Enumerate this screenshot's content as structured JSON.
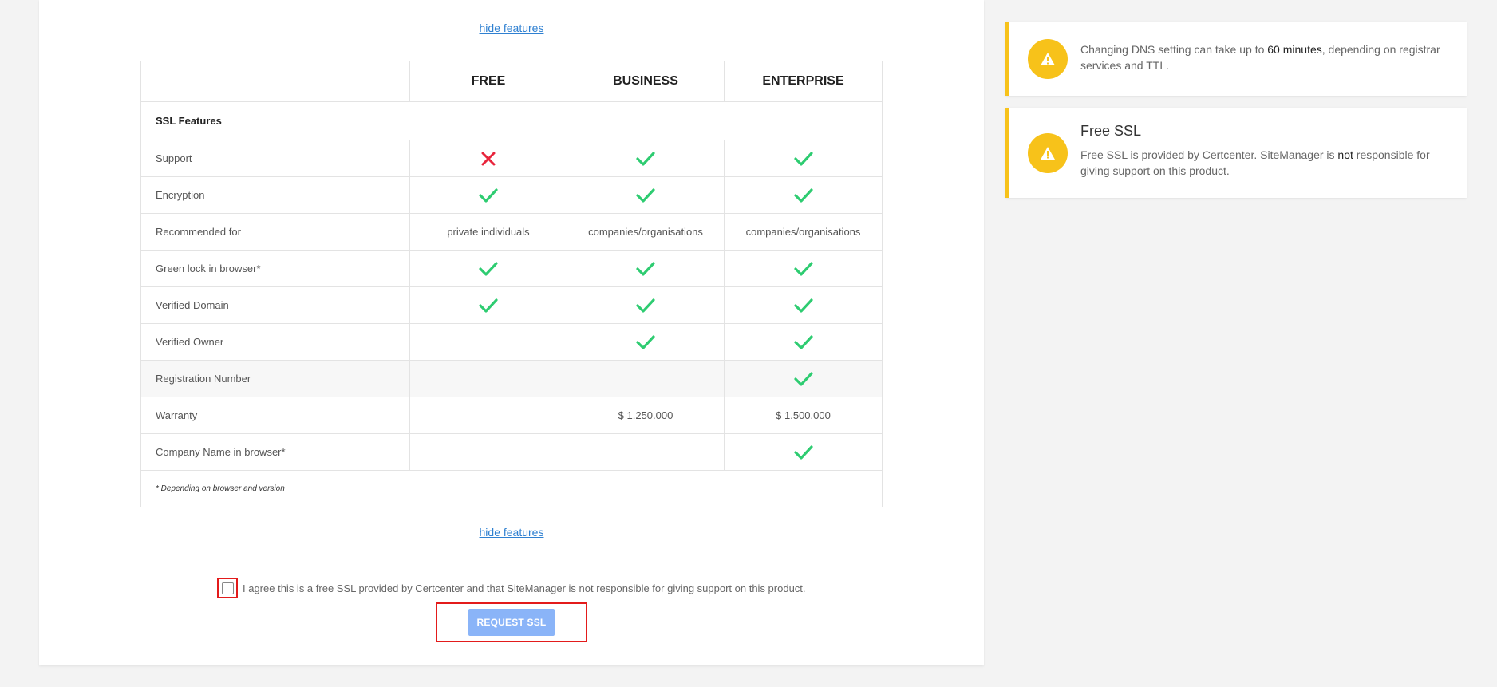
{
  "links": {
    "hide_features_top": "hide features",
    "hide_features_bottom": "hide features"
  },
  "table": {
    "columns": [
      "",
      "FREE",
      "BUSINESS",
      "ENTERPRISE"
    ],
    "section_title": "SSL Features",
    "rows": [
      {
        "label": "Support",
        "cells": [
          "cross-icon",
          "check-icon",
          "check-icon"
        ]
      },
      {
        "label": "Encryption",
        "cells": [
          "check-icon",
          "check-icon",
          "check-icon"
        ]
      },
      {
        "label": "Recommended for",
        "cells": [
          "private individuals",
          "companies/organisations",
          "companies/organisations"
        ]
      },
      {
        "label": "Green lock in browser*",
        "cells": [
          "check-icon",
          "check-icon",
          "check-icon"
        ]
      },
      {
        "label": "Verified Domain",
        "cells": [
          "check-icon",
          "check-icon",
          "check-icon"
        ]
      },
      {
        "label": "Verified Owner",
        "cells": [
          "",
          "check-icon",
          "check-icon"
        ]
      },
      {
        "label": "Registration Number",
        "cells": [
          "",
          "",
          "check-icon"
        ]
      },
      {
        "label": "Warranty",
        "cells": [
          "",
          "$ 1.250.000",
          "$ 1.500.000"
        ]
      },
      {
        "label": "Company Name in browser*",
        "cells": [
          "",
          "",
          "check-icon"
        ]
      }
    ],
    "footnote": "* Depending on browser and version"
  },
  "agreement": {
    "label": "I agree this is a free SSL provided by Certcenter and that SiteManager is not responsible for giving support on this product.",
    "checked": false
  },
  "request_button": {
    "label": "REQUEST SSL"
  },
  "sidebar": {
    "dns_notice": {
      "text_before": "Changing DNS setting can take up to ",
      "text_bold": "60 minutes",
      "text_after": ", depending on registrar services and TTL."
    },
    "free_ssl_notice": {
      "title": "Free SSL",
      "text_before": "Free SSL is provided by Certcenter. SiteManager is ",
      "text_bold": "not",
      "text_after": " responsible for giving support on this product."
    }
  },
  "colors": {
    "check": "#2ecc71",
    "cross": "#e8253c",
    "accent_yellow": "#f7c21a",
    "link": "#2f80d1",
    "button": "#8ab4f8",
    "highlight": "#e31b1b"
  }
}
